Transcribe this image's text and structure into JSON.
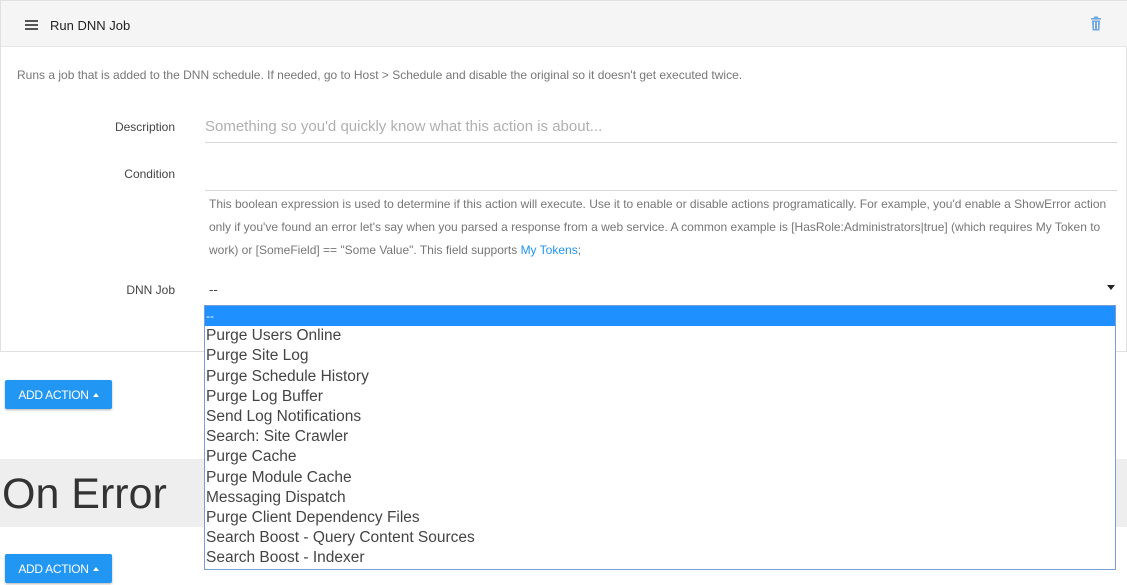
{
  "card": {
    "title": "Run DNN Job",
    "intro": "Runs a job that is added to the DNN schedule. If needed, go to Host > Schedule and disable the original so it doesn't get executed twice."
  },
  "description": {
    "label": "Description",
    "placeholder": "Something so you'd quickly know what this action is about...",
    "value": ""
  },
  "condition": {
    "label": "Condition",
    "value": "",
    "help": "This boolean expression is used to determine if this action will execute. Use it to enable or disable actions programatically. For example, you'd enable a ShowError action only if you've found an error let's say when you parsed a response from a web service. A common example is [HasRole:Administrators|true] (which requires My Token to work) or [SomeField] == \"Some Value\". This field supports",
    "help_link": "My Tokens",
    "help_suffix": ";"
  },
  "dnn_job": {
    "label": "DNN Job",
    "selected": "--",
    "options": [
      "--",
      "Purge Users Online",
      "Purge Site Log",
      "Purge Schedule History",
      "Purge Log Buffer",
      "Send Log Notifications",
      "Search: Site Crawler",
      "Purge Cache",
      "Purge Module Cache",
      "Messaging Dispatch",
      "Purge Client Dependency Files",
      "Search Boost - Query Content Sources",
      "Search Boost - Indexer"
    ]
  },
  "buttons": {
    "add_action": "ADD ACTION"
  },
  "section": {
    "on_error": "On Error"
  },
  "colors": {
    "accent": "#2196f3",
    "selected_option": "#1e90ff"
  },
  "icons": [
    "menu-icon",
    "trash-icon",
    "dropdown-caret-icon"
  ]
}
